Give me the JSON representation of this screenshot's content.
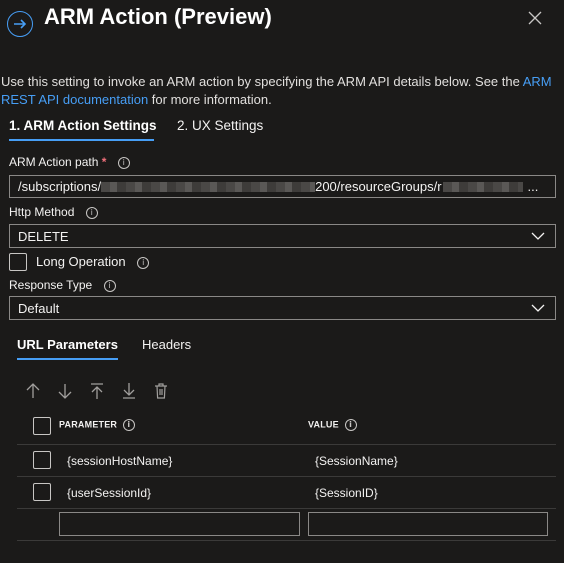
{
  "header": {
    "title": "ARM Action (Preview)"
  },
  "description": {
    "text_before": "Use this setting to invoke an ARM action by specifying the ARM API details below. See the ",
    "link": "ARM REST API documentation",
    "text_after": " for more information."
  },
  "tabs": [
    {
      "label": "1. ARM Action Settings",
      "active": true
    },
    {
      "label": "2. UX Settings",
      "active": false
    }
  ],
  "form": {
    "arm_action_path": {
      "label": "ARM Action path",
      "required_mark": "*",
      "value_start": "/subscriptions/",
      "value_mid": "200/resourceGroups/r",
      "value_end": "..."
    },
    "http_method": {
      "label": "Http Method",
      "value": "DELETE"
    },
    "long_operation": {
      "label": "Long Operation",
      "checked": false
    },
    "response_type": {
      "label": "Response Type",
      "value": "Default"
    }
  },
  "subtabs": [
    {
      "label": "URL Parameters",
      "active": true
    },
    {
      "label": "Headers",
      "active": false
    }
  ],
  "toolbar": {
    "icons": [
      "move-up-icon",
      "move-down-icon",
      "move-to-top-icon",
      "move-to-bottom-icon",
      "delete-icon"
    ]
  },
  "table": {
    "columns": [
      "PARAMETER",
      "VALUE"
    ],
    "rows": [
      {
        "parameter": "{sessionHostName}",
        "value": "{SessionName}"
      },
      {
        "parameter": "{userSessionId}",
        "value": "{SessionID}"
      }
    ],
    "new_row": {
      "parameter": "",
      "value": ""
    }
  },
  "colors": {
    "background": "#1b1a19",
    "accent": "#479ef5",
    "required": "#f1707b",
    "border": "#8a8886"
  }
}
